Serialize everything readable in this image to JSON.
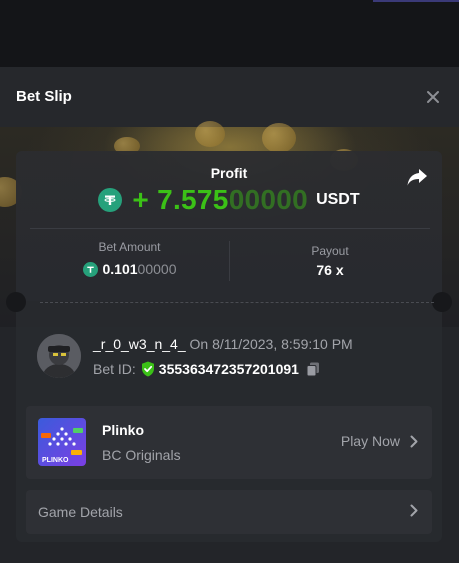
{
  "modal": {
    "title": "Bet Slip"
  },
  "result": {
    "profit_label": "Profit",
    "profit_sign": "+",
    "profit_main": "7.575",
    "profit_trailing": "00000",
    "currency": "USDT",
    "bet_amount_label": "Bet Amount",
    "bet_amount_main": "0.101",
    "bet_amount_trailing": "00000",
    "payout_label": "Payout",
    "payout_value": "76 x"
  },
  "bet": {
    "username": "_r_0_w3_n_4_",
    "timestamp": "On 8/11/2023, 8:59:10 PM",
    "bet_id_label": "Bet ID:",
    "bet_id": "355363472357201091"
  },
  "game": {
    "name": "Plinko",
    "provider": "BC Originals",
    "play_label": "Play Now",
    "thumb_text": "PLINKO"
  },
  "details": {
    "label": "Game Details"
  },
  "icons": {
    "close": "close-icon",
    "share": "share-icon",
    "tether": "tether-icon",
    "verified": "shield-check-icon",
    "copy": "copy-icon",
    "chevron": "chevron-right-icon"
  },
  "colors": {
    "profit_green": "#3bc117",
    "tether_green": "#26a17b",
    "verified_green": "#3bc117",
    "panel": "#232529"
  }
}
